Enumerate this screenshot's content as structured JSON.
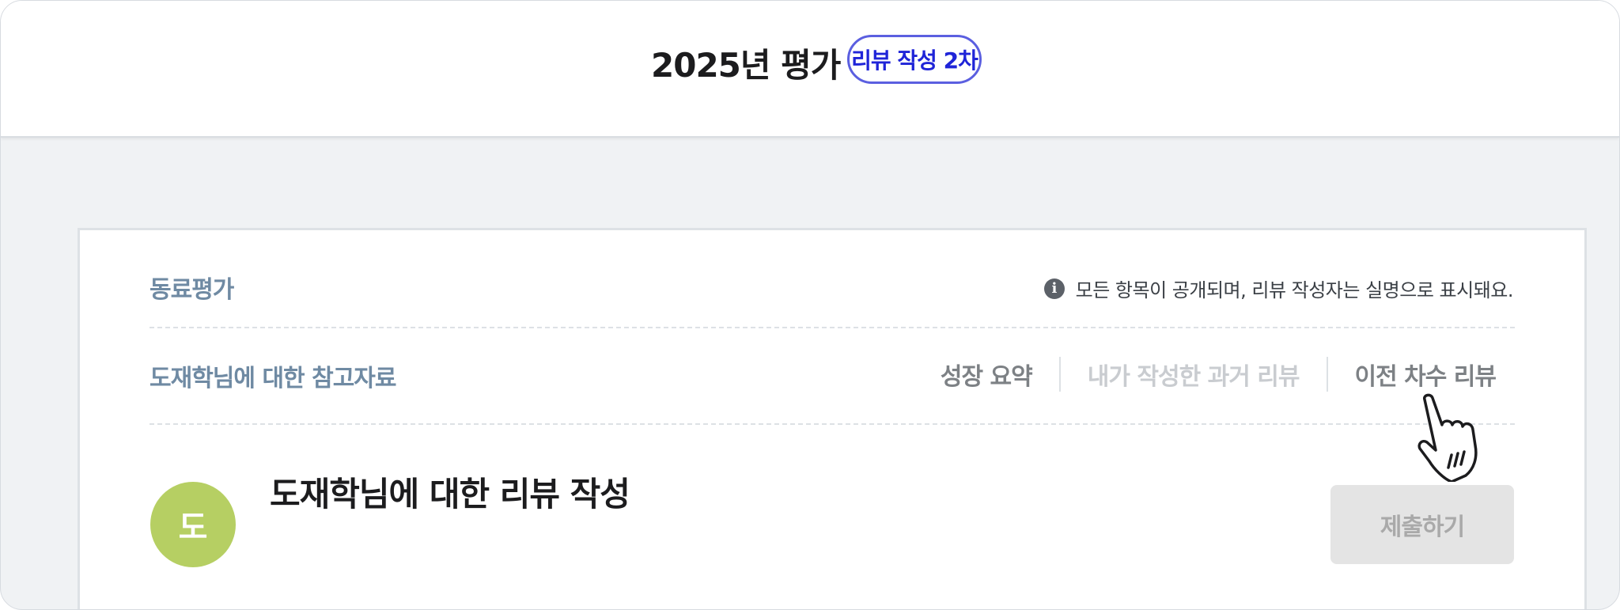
{
  "header": {
    "title": "2025년 평가",
    "round_badge": "리뷰 작성 2차"
  },
  "section": {
    "label": "동료평가",
    "notice": "모든 항목이 공개되며, 리뷰 작성자는 실명으로 표시돼요.",
    "notice_icon": "info-icon"
  },
  "reference": {
    "label": "도재학님에 대한 참고자료",
    "tabs": [
      {
        "label": "성장 요약",
        "state": "enabled"
      },
      {
        "label": "내가 작성한 과거 리뷰",
        "state": "disabled"
      },
      {
        "label": "이전 차수 리뷰",
        "state": "enabled"
      }
    ]
  },
  "review": {
    "avatar_initial": "도",
    "title": "도재학님에 대한 리뷰 작성",
    "submit_label": "제출하기"
  },
  "colors": {
    "accent": "#5b5fe0",
    "muted_label": "#6f8aa3",
    "avatar": "#b6cf63"
  }
}
